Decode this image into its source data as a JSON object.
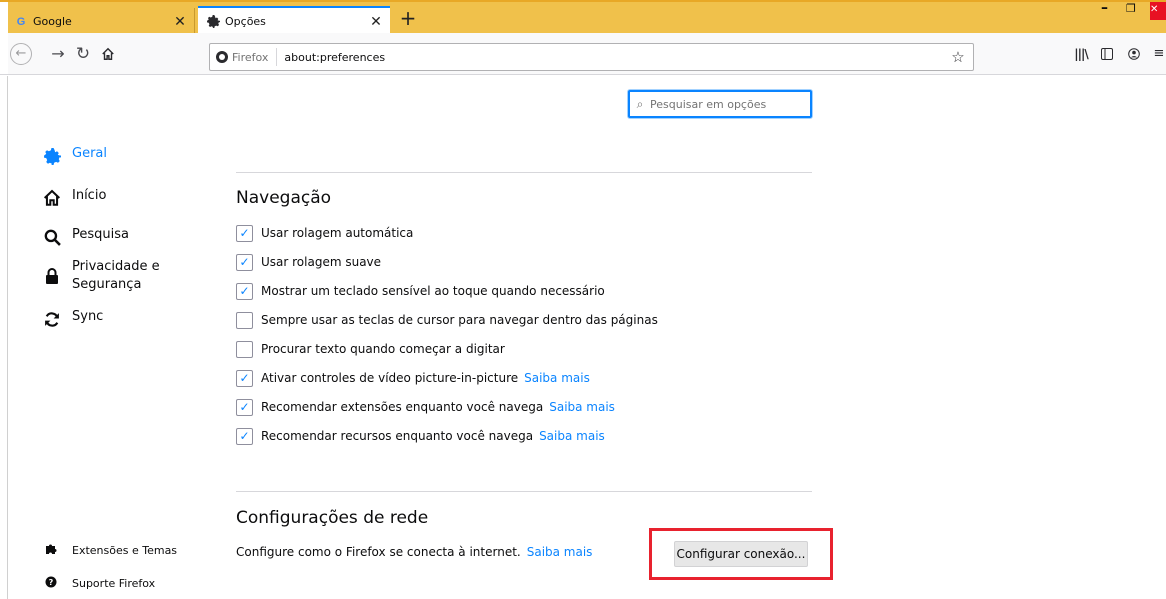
{
  "tabs": [
    {
      "favicon": "G",
      "title": "Google",
      "close": "✕"
    },
    {
      "favicon": "gear-icon",
      "title": "Opções",
      "close": "✕"
    }
  ],
  "new_tab_label": "+",
  "window_controls": {
    "minimize": "–",
    "maximize": "❐",
    "close": "✕"
  },
  "navbar": {
    "identity_label": "Firefox",
    "url": "about:preferences"
  },
  "search": {
    "placeholder": "Pesquisar em opções"
  },
  "sidebar": {
    "categories": [
      {
        "label": "Geral",
        "icon": "gear-icon",
        "selected": true
      },
      {
        "label": "Início",
        "icon": "home-icon"
      },
      {
        "label": "Pesquisa",
        "icon": "search-icon"
      },
      {
        "label_line1": "Privacidade e",
        "label_line2": "Segurança",
        "icon": "lock-icon"
      },
      {
        "label": "Sync",
        "icon": "sync-icon"
      }
    ],
    "footer": [
      {
        "label": "Extensões e Temas",
        "icon": "puzzle-icon"
      },
      {
        "label": "Suporte Firefox",
        "icon": "help-icon"
      }
    ]
  },
  "navegacao": {
    "title": "Navegação",
    "options": [
      {
        "label": "Usar rolagem automática",
        "checked": true
      },
      {
        "label": "Usar rolagem suave",
        "checked": true
      },
      {
        "label": "Mostrar um teclado sensível ao toque quando necessário",
        "checked": true
      },
      {
        "label": "Sempre usar as teclas de cursor para navegar dentro das páginas",
        "checked": false
      },
      {
        "label": "Procurar texto quando começar a digitar",
        "checked": false
      },
      {
        "label": "Ativar controles de vídeo picture-in-picture",
        "checked": true,
        "link": "Saiba mais"
      },
      {
        "label": "Recomendar extensões enquanto você navega",
        "checked": true,
        "link": "Saiba mais"
      },
      {
        "label": "Recomendar recursos enquanto você navega",
        "checked": true,
        "link": "Saiba mais"
      }
    ]
  },
  "rede": {
    "title": "Configurações de rede",
    "description": "Configure como o Firefox se conecta à internet.",
    "link": "Saiba mais",
    "button": "Configurar conexão..."
  },
  "colors": {
    "accent": "#0a84ff",
    "tabstrip": "#f0c14b",
    "highlight": "#e8222e"
  }
}
